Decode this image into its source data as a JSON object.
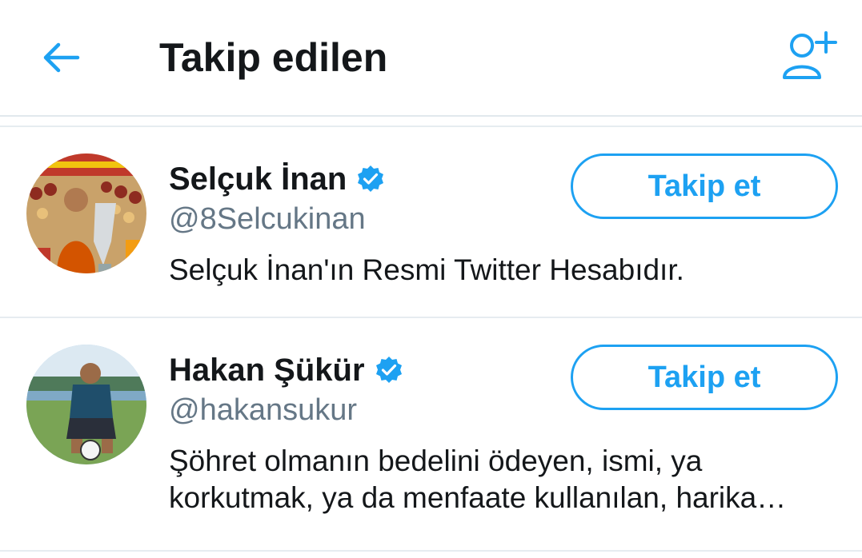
{
  "header": {
    "title": "Takip edilen",
    "back_icon": "arrow-left-icon",
    "add_icon": "add-user-icon",
    "accent": "#1da1f2"
  },
  "users": [
    {
      "name": "Selçuk İnan",
      "handle": "@8Selcukinan",
      "bio": "Selçuk İnan'ın Resmi Twitter Hesabıdır.",
      "follow_label": "Takip et",
      "verified": true
    },
    {
      "name": "Hakan Şükür",
      "handle": "@hakansukur",
      "bio": "Şöhret olmanın bedelini ödeyen, ismi, ya korkutmak, ya da menfaate kullanılan, harika…",
      "follow_label": "Takip et",
      "verified": true
    }
  ]
}
